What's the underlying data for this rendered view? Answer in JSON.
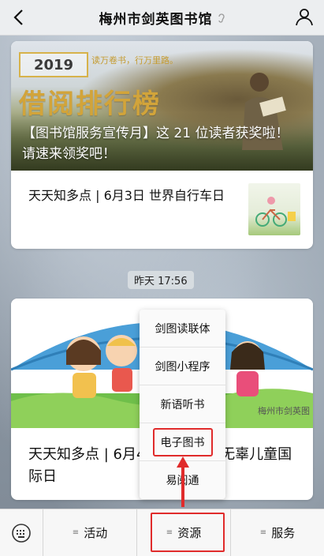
{
  "header": {
    "title": "梅州市剑英图书馆"
  },
  "article1": {
    "banner_year": "2019",
    "banner_slogan": "读万卷书，行万里路。",
    "banner_big_title": "借阅排行榜",
    "banner_caption": "【图书馆服务宣传月】这 21 位读者获奖啦！请速来领奖吧！",
    "item_title": "天天知多点 | 6月3日 世界自行车日"
  },
  "timestamp": "昨天 17:56",
  "article2": {
    "item_title": "天天知多点 | 6月4日 受侵害的无辜儿童国际日",
    "watermark": "梅州市剑英图"
  },
  "popup_menu": {
    "items": [
      {
        "label": "剑图读联体"
      },
      {
        "label": "剑图小程序"
      },
      {
        "label": "新语听书"
      },
      {
        "label": "电子图书"
      },
      {
        "label": "易阅通"
      }
    ],
    "selected_index": 3
  },
  "bottom_menu": {
    "items": [
      {
        "label": "活动"
      },
      {
        "label": "资源"
      },
      {
        "label": "服务"
      }
    ],
    "highlighted_index": 1
  },
  "colors": {
    "highlight_red": "#e02b2b",
    "banner_gold": "#d2a43a"
  }
}
